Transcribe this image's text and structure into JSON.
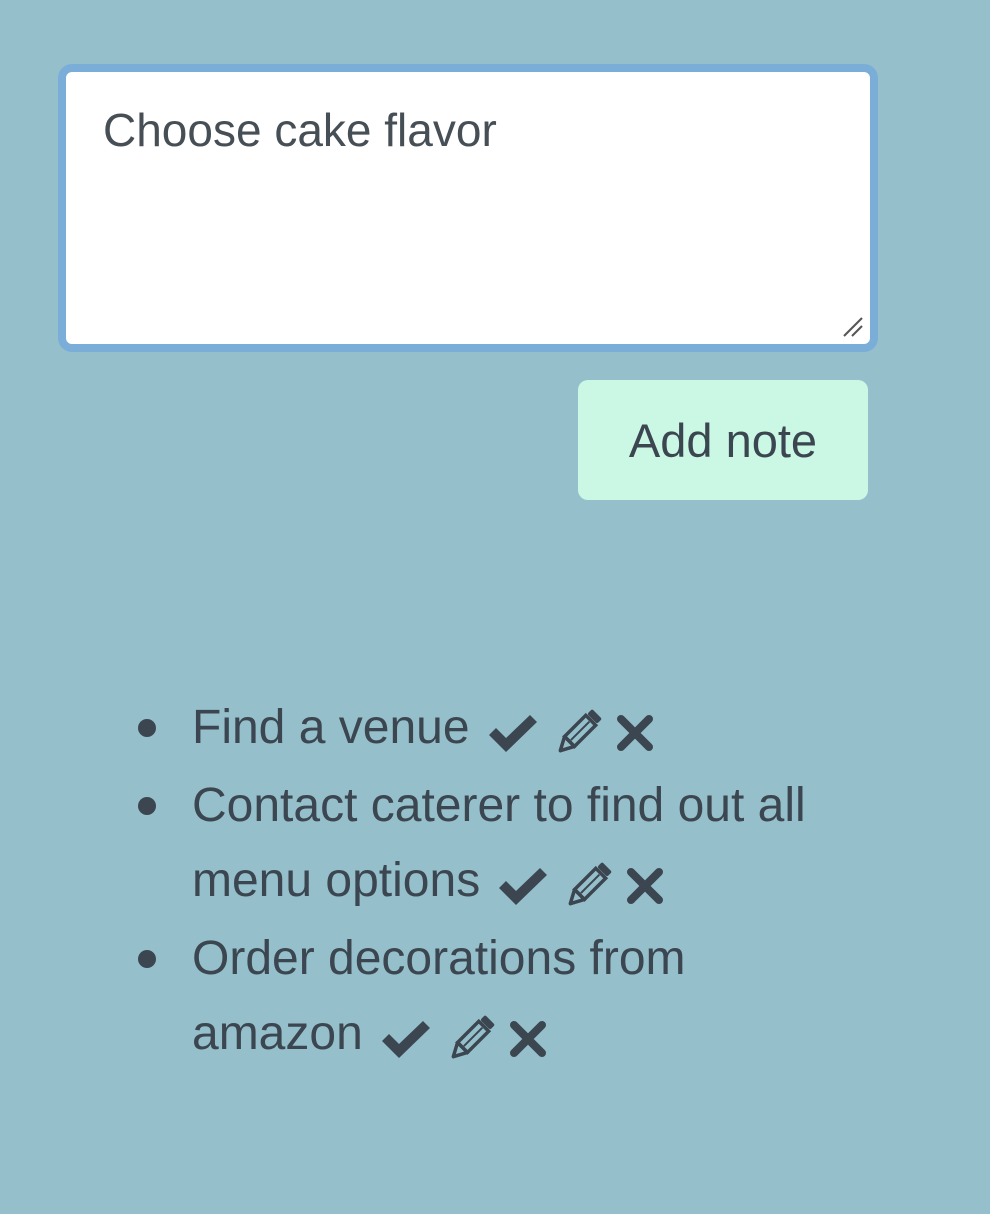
{
  "form": {
    "textarea_value": "Choose cake flavor",
    "add_button_label": "Add note"
  },
  "notes": [
    {
      "text": "Find a venue"
    },
    {
      "text": "Contact caterer to find out all menu options"
    },
    {
      "text": "Order decorations from amazon"
    }
  ],
  "icons": {
    "complete": "check-icon",
    "edit": "pencil-icon",
    "delete": "close-icon"
  },
  "colors": {
    "background": "#95c0cb",
    "text": "#3b4650",
    "focus_ring": "#7aaed8",
    "button_bg": "#cbf8e5"
  }
}
